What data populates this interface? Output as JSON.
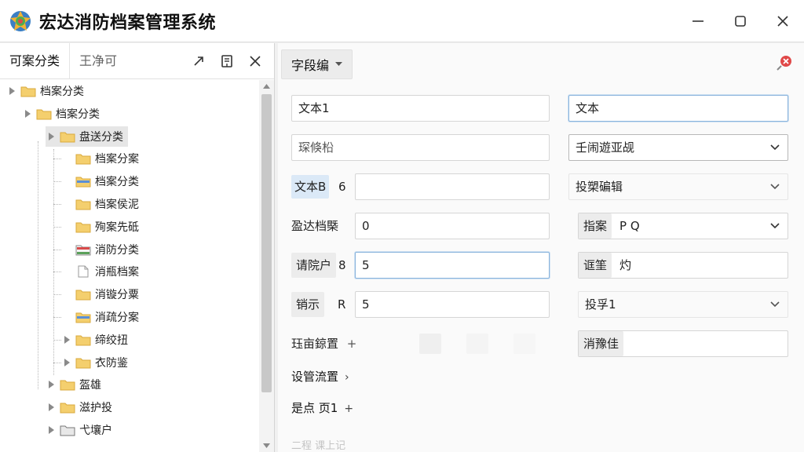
{
  "window": {
    "title": "宏达消防档案管理系统",
    "logo_icon": "app-logo-icon",
    "controls": [
      "minimize-icon",
      "maximize-icon",
      "close-icon"
    ]
  },
  "left": {
    "tabs": [
      {
        "label": "可案分类",
        "active": true
      },
      {
        "label": "王净可",
        "active": false
      }
    ],
    "tools": [
      "pin-icon",
      "notes-icon",
      "close-icon"
    ],
    "tree": [
      {
        "label": "档案分类",
        "level": 0,
        "arrow": true,
        "icon": "folder"
      },
      {
        "label": "档案分类",
        "level": 1,
        "arrow": true,
        "icon": "folder"
      },
      {
        "label": "盘送分类",
        "level": 2,
        "arrow": true,
        "icon": "folder",
        "selected": true
      },
      {
        "label": "档案分案",
        "level": 3,
        "arrow": false,
        "icon": "folder"
      },
      {
        "label": "档案分类",
        "level": 3,
        "arrow": false,
        "icon": "folder-blue"
      },
      {
        "label": "档案侯泥",
        "level": 3,
        "arrow": false,
        "icon": "folder"
      },
      {
        "label": "殉案先砥",
        "level": 3,
        "arrow": false,
        "icon": "folder"
      },
      {
        "label": "消防分类",
        "level": 3,
        "arrow": false,
        "icon": "folder-red"
      },
      {
        "label": "消瓶档案",
        "level": 3,
        "arrow": false,
        "icon": "document"
      },
      {
        "label": "消镟分粟",
        "level": 3,
        "arrow": false,
        "icon": "folder"
      },
      {
        "label": "消疏分案",
        "level": 3,
        "arrow": false,
        "icon": "folder-blue"
      },
      {
        "label": "缔绞扭",
        "level": 3,
        "arrow": true,
        "icon": "folder"
      },
      {
        "label": "衣防鉴",
        "level": 3,
        "arrow": true,
        "icon": "folder"
      },
      {
        "label": "盔雄",
        "level": 2,
        "arrow": true,
        "icon": "folder"
      },
      {
        "label": "滋护投",
        "level": 2,
        "arrow": true,
        "icon": "folder"
      },
      {
        "label": "弋壤户",
        "level": 2,
        "arrow": true,
        "icon": "folder-gray"
      }
    ]
  },
  "right": {
    "field_tab": "字段编",
    "form": {
      "r1_left_value": "文本1",
      "r1_right_value": "文本",
      "r2_left_value": "琛倏柗",
      "r2_right_select": "壬闹遊亚觇",
      "r3_label": "文本B",
      "r3_label_num": "6",
      "r3_right_select": "投槊碥辑",
      "r4_label": "盈达档槩",
      "r4_value": "0",
      "r4_right_label": "指案",
      "r4_right_value": "P Q",
      "r5_label": "请院户",
      "r5_label_num": "8",
      "r5_value": "5",
      "r5_right_label": "诓筀",
      "r5_right_value": "灼",
      "r6_label": "销示",
      "r6_label_r": "R",
      "r6_value": "5",
      "r6_right_select": "投孚1",
      "r7_label": "珏亩鍄置",
      "r7_sym": "+",
      "r7_right_label": "消豫佳",
      "exp1": "设管流置",
      "exp1_sym": "›",
      "exp2": "是点 页1",
      "exp2_sym": "+",
      "faded_bottom": "二程  课上记"
    }
  },
  "colors": {
    "accent_focus": "#8ab4dc",
    "close_red": "#e04848",
    "folder_yellow": "#f4cf6e"
  }
}
